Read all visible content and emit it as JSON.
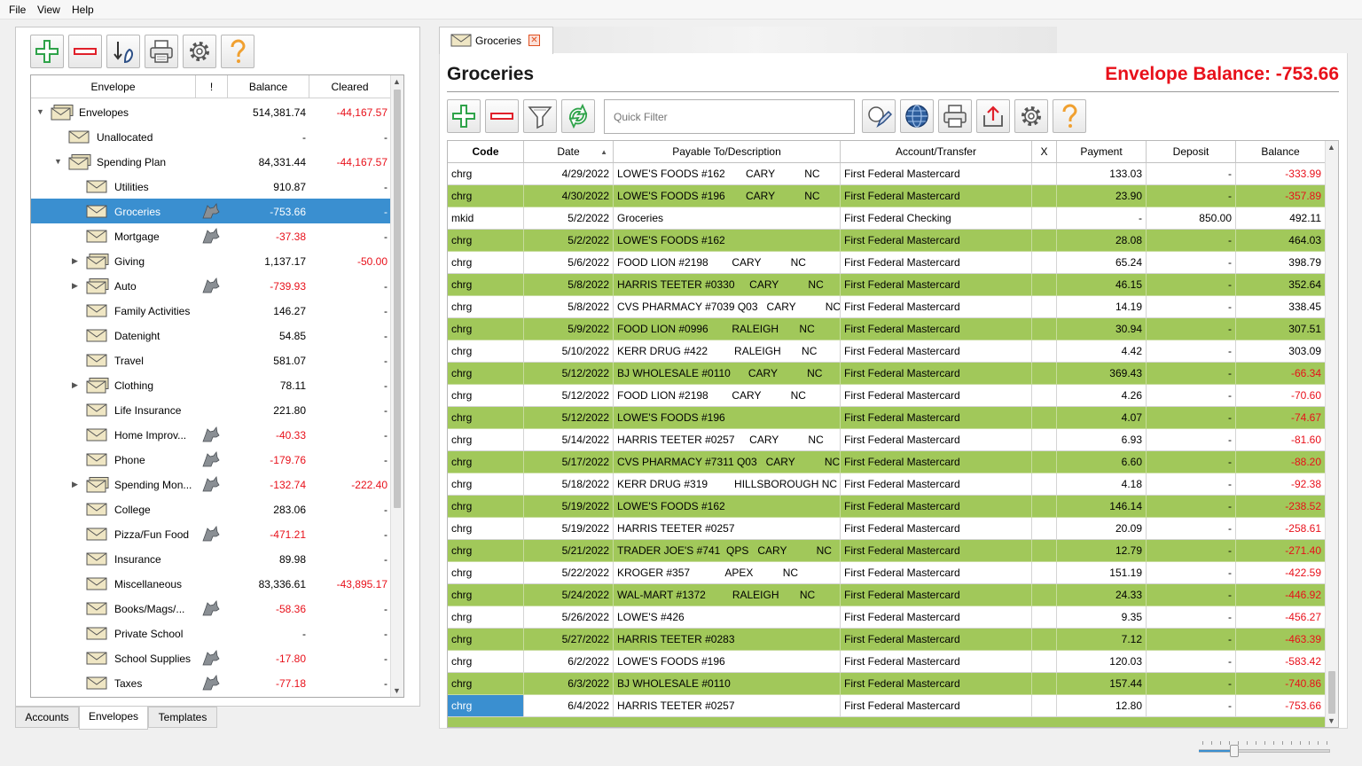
{
  "menu": [
    "File",
    "View",
    "Help"
  ],
  "left_toolbar": [
    "add-icon",
    "remove-icon",
    "transfer-icon",
    "print-icon",
    "settings-icon",
    "help-icon"
  ],
  "tree": {
    "headers": {
      "envelope": "Envelope",
      "flag": "!",
      "balance": "Balance",
      "cleared": "Cleared"
    },
    "rows": [
      {
        "level": 0,
        "expander": "open",
        "icon": "multi",
        "name": "Envelopes",
        "wolf": false,
        "balance": "514,381.74",
        "bal_neg": false,
        "cleared": "-44,167.57",
        "clr_neg": true
      },
      {
        "level": 1,
        "expander": "",
        "icon": "single",
        "name": "Unallocated",
        "wolf": false,
        "balance": "-",
        "bal_neg": false,
        "cleared": "-",
        "clr_neg": false
      },
      {
        "level": 1,
        "expander": "open",
        "icon": "multi",
        "name": "Spending Plan",
        "wolf": false,
        "balance": "84,331.44",
        "bal_neg": false,
        "cleared": "-44,167.57",
        "clr_neg": true
      },
      {
        "level": 2,
        "expander": "",
        "icon": "single",
        "name": "Utilities",
        "wolf": false,
        "balance": "910.87",
        "bal_neg": false,
        "cleared": "-",
        "clr_neg": false
      },
      {
        "level": 2,
        "expander": "",
        "icon": "single",
        "name": "Groceries",
        "wolf": true,
        "balance": "-753.66",
        "bal_neg": true,
        "cleared": "-",
        "clr_neg": false,
        "selected": true
      },
      {
        "level": 2,
        "expander": "",
        "icon": "single",
        "name": "Mortgage",
        "wolf": true,
        "balance": "-37.38",
        "bal_neg": true,
        "cleared": "-",
        "clr_neg": false
      },
      {
        "level": 2,
        "expander": "closed",
        "icon": "multi",
        "name": "Giving",
        "wolf": false,
        "balance": "1,137.17",
        "bal_neg": false,
        "cleared": "-50.00",
        "clr_neg": true
      },
      {
        "level": 2,
        "expander": "closed",
        "icon": "multi",
        "name": "Auto",
        "wolf": true,
        "balance": "-739.93",
        "bal_neg": true,
        "cleared": "-",
        "clr_neg": false
      },
      {
        "level": 2,
        "expander": "",
        "icon": "single",
        "name": "Family Activities",
        "wolf": false,
        "balance": "146.27",
        "bal_neg": false,
        "cleared": "-",
        "clr_neg": false
      },
      {
        "level": 2,
        "expander": "",
        "icon": "single",
        "name": "Datenight",
        "wolf": false,
        "balance": "54.85",
        "bal_neg": false,
        "cleared": "-",
        "clr_neg": false
      },
      {
        "level": 2,
        "expander": "",
        "icon": "single",
        "name": "Travel",
        "wolf": false,
        "balance": "581.07",
        "bal_neg": false,
        "cleared": "-",
        "clr_neg": false
      },
      {
        "level": 2,
        "expander": "closed",
        "icon": "multi",
        "name": "Clothing",
        "wolf": false,
        "balance": "78.11",
        "bal_neg": false,
        "cleared": "-",
        "clr_neg": false
      },
      {
        "level": 2,
        "expander": "",
        "icon": "single",
        "name": "Life Insurance",
        "wolf": false,
        "balance": "221.80",
        "bal_neg": false,
        "cleared": "-",
        "clr_neg": false
      },
      {
        "level": 2,
        "expander": "",
        "icon": "single",
        "name": "Home Improv...",
        "wolf": true,
        "balance": "-40.33",
        "bal_neg": true,
        "cleared": "-",
        "clr_neg": false
      },
      {
        "level": 2,
        "expander": "",
        "icon": "single",
        "name": "Phone",
        "wolf": true,
        "balance": "-179.76",
        "bal_neg": true,
        "cleared": "-",
        "clr_neg": false
      },
      {
        "level": 2,
        "expander": "closed",
        "icon": "multi",
        "name": "Spending Mon...",
        "wolf": true,
        "balance": "-132.74",
        "bal_neg": true,
        "cleared": "-222.40",
        "clr_neg": true
      },
      {
        "level": 2,
        "expander": "",
        "icon": "single",
        "name": "College",
        "wolf": false,
        "balance": "283.06",
        "bal_neg": false,
        "cleared": "-",
        "clr_neg": false
      },
      {
        "level": 2,
        "expander": "",
        "icon": "single",
        "name": "Pizza/Fun Food",
        "wolf": true,
        "balance": "-471.21",
        "bal_neg": true,
        "cleared": "-",
        "clr_neg": false
      },
      {
        "level": 2,
        "expander": "",
        "icon": "single",
        "name": "Insurance",
        "wolf": false,
        "balance": "89.98",
        "bal_neg": false,
        "cleared": "-",
        "clr_neg": false
      },
      {
        "level": 2,
        "expander": "",
        "icon": "single",
        "name": "Miscellaneous",
        "wolf": false,
        "balance": "83,336.61",
        "bal_neg": false,
        "cleared": "-43,895.17",
        "clr_neg": true
      },
      {
        "level": 2,
        "expander": "",
        "icon": "single",
        "name": "Books/Mags/...",
        "wolf": true,
        "balance": "-58.36",
        "bal_neg": true,
        "cleared": "-",
        "clr_neg": false
      },
      {
        "level": 2,
        "expander": "",
        "icon": "single",
        "name": "Private School",
        "wolf": false,
        "balance": "-",
        "bal_neg": false,
        "cleared": "-",
        "clr_neg": false
      },
      {
        "level": 2,
        "expander": "",
        "icon": "single",
        "name": "School Supplies",
        "wolf": true,
        "balance": "-17.80",
        "bal_neg": true,
        "cleared": "-",
        "clr_neg": false
      },
      {
        "level": 2,
        "expander": "",
        "icon": "single",
        "name": "Taxes",
        "wolf": true,
        "balance": "-77.18",
        "bal_neg": true,
        "cleared": "-",
        "clr_neg": false
      }
    ]
  },
  "bottom_tabs": [
    "Accounts",
    "Envelopes",
    "Templates"
  ],
  "active_bottom_tab": "Envelopes",
  "doc_tab": {
    "label": "Groceries",
    "close_icon": "close-icon"
  },
  "register": {
    "title": "Groceries",
    "envelope_balance": "Envelope Balance: -753.66",
    "quick_filter_placeholder": "Quick Filter",
    "toolbar": [
      "add-icon",
      "remove-icon",
      "filter-icon",
      "sync-icon",
      "edit-icon",
      "globe-icon",
      "print-icon",
      "export-icon",
      "settings-icon",
      "help-icon"
    ],
    "columns": [
      "Code",
      "Date",
      "Payable To/Description",
      "Account/Transfer",
      "X",
      "Payment",
      "Deposit",
      "Balance"
    ],
    "rows": [
      {
        "code": "chrg",
        "date": "4/29/2022",
        "payee": "LOWE'S FOODS #162       CARY          NC",
        "account": "First Federal Mastercard",
        "x": "",
        "payment": "133.03",
        "deposit": "-",
        "balance": "-333.99",
        "neg": true
      },
      {
        "code": "chrg",
        "date": "4/30/2022",
        "payee": "LOWE'S FOODS #196       CARY          NC",
        "account": "First Federal Mastercard",
        "x": "",
        "payment": "23.90",
        "deposit": "-",
        "balance": "-357.89",
        "neg": true
      },
      {
        "code": "mkid",
        "date": "5/2/2022",
        "payee": "Groceries",
        "account": "First Federal Checking",
        "x": "",
        "payment": "-",
        "deposit": "850.00",
        "balance": "492.11",
        "neg": false
      },
      {
        "code": "chrg",
        "date": "5/2/2022",
        "payee": "LOWE'S FOODS #162",
        "account": "First Federal Mastercard",
        "x": "",
        "payment": "28.08",
        "deposit": "-",
        "balance": "464.03",
        "neg": false
      },
      {
        "code": "chrg",
        "date": "5/6/2022",
        "payee": "FOOD LION #2198        CARY          NC",
        "account": "First Federal Mastercard",
        "x": "",
        "payment": "65.24",
        "deposit": "-",
        "balance": "398.79",
        "neg": false
      },
      {
        "code": "chrg",
        "date": "5/8/2022",
        "payee": "HARRIS TEETER #0330     CARY          NC",
        "account": "First Federal Mastercard",
        "x": "",
        "payment": "46.15",
        "deposit": "-",
        "balance": "352.64",
        "neg": false
      },
      {
        "code": "chrg",
        "date": "5/8/2022",
        "payee": "CVS PHARMACY #7039 Q03   CARY          NC",
        "account": "First Federal Mastercard",
        "x": "",
        "payment": "14.19",
        "deposit": "-",
        "balance": "338.45",
        "neg": false
      },
      {
        "code": "chrg",
        "date": "5/9/2022",
        "payee": "FOOD LION #0996        RALEIGH       NC",
        "account": "First Federal Mastercard",
        "x": "",
        "payment": "30.94",
        "deposit": "-",
        "balance": "307.51",
        "neg": false
      },
      {
        "code": "chrg",
        "date": "5/10/2022",
        "payee": "KERR DRUG #422         RALEIGH       NC",
        "account": "First Federal Mastercard",
        "x": "",
        "payment": "4.42",
        "deposit": "-",
        "balance": "303.09",
        "neg": false
      },
      {
        "code": "chrg",
        "date": "5/12/2022",
        "payee": "BJ WHOLESALE #0110      CARY          NC",
        "account": "First Federal Mastercard",
        "x": "",
        "payment": "369.43",
        "deposit": "-",
        "balance": "-66.34",
        "neg": true
      },
      {
        "code": "chrg",
        "date": "5/12/2022",
        "payee": "FOOD LION #2198        CARY          NC",
        "account": "First Federal Mastercard",
        "x": "",
        "payment": "4.26",
        "deposit": "-",
        "balance": "-70.60",
        "neg": true
      },
      {
        "code": "chrg",
        "date": "5/12/2022",
        "payee": "LOWE'S FOODS #196",
        "account": "First Federal Mastercard",
        "x": "",
        "payment": "4.07",
        "deposit": "-",
        "balance": "-74.67",
        "neg": true
      },
      {
        "code": "chrg",
        "date": "5/14/2022",
        "payee": "HARRIS TEETER #0257     CARY          NC",
        "account": "First Federal Mastercard",
        "x": "",
        "payment": "6.93",
        "deposit": "-",
        "balance": "-81.60",
        "neg": true
      },
      {
        "code": "chrg",
        "date": "5/17/2022",
        "payee": "CVS PHARMACY #7311 Q03   CARY          NC",
        "account": "First Federal Mastercard",
        "x": "",
        "payment": "6.60",
        "deposit": "-",
        "balance": "-88.20",
        "neg": true
      },
      {
        "code": "chrg",
        "date": "5/18/2022",
        "payee": "KERR DRUG #319         HILLSBOROUGH NC",
        "account": "First Federal Mastercard",
        "x": "",
        "payment": "4.18",
        "deposit": "-",
        "balance": "-92.38",
        "neg": true
      },
      {
        "code": "chrg",
        "date": "5/19/2022",
        "payee": "LOWE'S FOODS #162",
        "account": "First Federal Mastercard",
        "x": "",
        "payment": "146.14",
        "deposit": "-",
        "balance": "-238.52",
        "neg": true
      },
      {
        "code": "chrg",
        "date": "5/19/2022",
        "payee": "HARRIS TEETER #0257",
        "account": "First Federal Mastercard",
        "x": "",
        "payment": "20.09",
        "deposit": "-",
        "balance": "-258.61",
        "neg": true
      },
      {
        "code": "chrg",
        "date": "5/21/2022",
        "payee": "TRADER JOE'S #741  QPS   CARY          NC",
        "account": "First Federal Mastercard",
        "x": "",
        "payment": "12.79",
        "deposit": "-",
        "balance": "-271.40",
        "neg": true
      },
      {
        "code": "chrg",
        "date": "5/22/2022",
        "payee": "KROGER #357            APEX          NC",
        "account": "First Federal Mastercard",
        "x": "",
        "payment": "151.19",
        "deposit": "-",
        "balance": "-422.59",
        "neg": true
      },
      {
        "code": "chrg",
        "date": "5/24/2022",
        "payee": "WAL-MART #1372         RALEIGH       NC",
        "account": "First Federal Mastercard",
        "x": "",
        "payment": "24.33",
        "deposit": "-",
        "balance": "-446.92",
        "neg": true
      },
      {
        "code": "chrg",
        "date": "5/26/2022",
        "payee": "LOWE'S #426",
        "account": "First Federal Mastercard",
        "x": "",
        "payment": "9.35",
        "deposit": "-",
        "balance": "-456.27",
        "neg": true
      },
      {
        "code": "chrg",
        "date": "5/27/2022",
        "payee": "HARRIS TEETER #0283",
        "account": "First Federal Mastercard",
        "x": "",
        "payment": "7.12",
        "deposit": "-",
        "balance": "-463.39",
        "neg": true
      },
      {
        "code": "chrg",
        "date": "6/2/2022",
        "payee": "LOWE'S FOODS #196",
        "account": "First Federal Mastercard",
        "x": "",
        "payment": "120.03",
        "deposit": "-",
        "balance": "-583.42",
        "neg": true
      },
      {
        "code": "chrg",
        "date": "6/3/2022",
        "payee": "BJ WHOLESALE #0110",
        "account": "First Federal Mastercard",
        "x": "",
        "payment": "157.44",
        "deposit": "-",
        "balance": "-740.86",
        "neg": true
      },
      {
        "code": "chrg",
        "date": "6/4/2022",
        "payee": "HARRIS TEETER #0257",
        "account": "First Federal Mastercard",
        "x": "",
        "payment": "12.80",
        "deposit": "-",
        "balance": "-753.66",
        "neg": true,
        "selected_code": true
      }
    ]
  },
  "colors": {
    "alt_row": "#a1c85a",
    "negative": "#e8101a",
    "selection": "#3a8fd0"
  }
}
